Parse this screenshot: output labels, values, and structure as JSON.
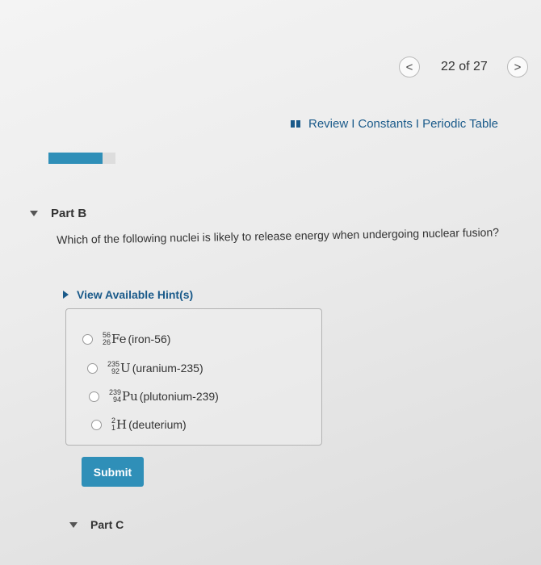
{
  "nav": {
    "prev_symbol": "<",
    "page_count": "22 of 27",
    "next_symbol": ">"
  },
  "links": {
    "review": "Review",
    "constants": "Constants",
    "periodic_table": "Periodic Table",
    "separator": "I"
  },
  "progress": {
    "fraction": 0.81
  },
  "part_b": {
    "title": "Part B",
    "question": "Which of the following nuclei is likely to release energy when undergoing nuclear fusion?",
    "hint_label": "View Available Hint(s)",
    "options": [
      {
        "mass": "56",
        "atomic": "26",
        "symbol": "Fe",
        "label": "(iron-56)"
      },
      {
        "mass": "235",
        "atomic": "92",
        "symbol": "U",
        "label": "(uranium-235)"
      },
      {
        "mass": "239",
        "atomic": "94",
        "symbol": "Pu",
        "label": "(plutonium-239)"
      },
      {
        "mass": "2",
        "atomic": "1",
        "symbol": "H",
        "label": "(deuterium)"
      }
    ],
    "submit_label": "Submit"
  },
  "part_c": {
    "title": "Part C"
  },
  "colors": {
    "accent": "#2f8fb8",
    "link": "#1a5a8a"
  }
}
